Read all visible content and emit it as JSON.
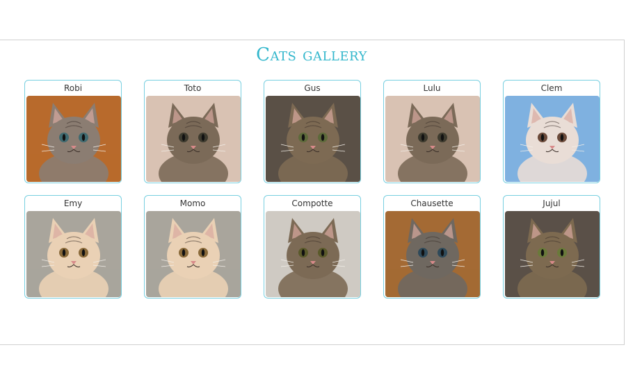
{
  "gallery": {
    "title": "Cats gallery",
    "cats": [
      {
        "name": "Robi",
        "fur": "#8b7d72",
        "bg": "#b86a2c",
        "eyes": "#3f6a70"
      },
      {
        "name": "Toto",
        "fur": "#7b6a58",
        "bg": "#d9c2b3",
        "eyes": "#3d3a2e"
      },
      {
        "name": "Gus",
        "fur": "#7d6a53",
        "bg": "#5a5046",
        "eyes": "#5d6a3a"
      },
      {
        "name": "Lulu",
        "fur": "#7b6a58",
        "bg": "#d9c2b3",
        "eyes": "#3d3a2e"
      },
      {
        "name": "Clem",
        "fur": "#e9ddd6",
        "bg": "#7fb1e0",
        "eyes": "#6b4a3a"
      },
      {
        "name": "Emy",
        "fur": "#ead1b5",
        "bg": "#a9a59c",
        "eyes": "#8a6a3a"
      },
      {
        "name": "Momo",
        "fur": "#ead1b5",
        "bg": "#a9a59c",
        "eyes": "#8a6a3a"
      },
      {
        "name": "Compotte",
        "fur": "#7c6a55",
        "bg": "#cfcac3",
        "eyes": "#5a5a2a"
      },
      {
        "name": "Chausette",
        "fur": "#6f6860",
        "bg": "#a46a34",
        "eyes": "#2f4a5a"
      },
      {
        "name": "Jujul",
        "fur": "#7d6a50",
        "bg": "#5a5048",
        "eyes": "#6a7a3a"
      }
    ]
  }
}
